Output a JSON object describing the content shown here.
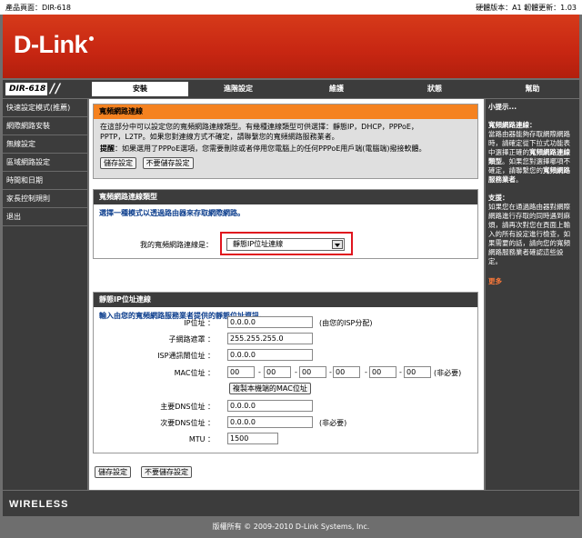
{
  "top": {
    "product": "產品頁面：DIR-618",
    "version": "硬體版本：A1   韌體更新：1.03"
  },
  "brand": {
    "logo": "D-Link",
    "wireless": "WIRELESS",
    "model": "DIR-618"
  },
  "tabs": [
    "安裝",
    "進階設定",
    "維護",
    "狀態",
    "幫助"
  ],
  "sidebar": [
    "快速設定模式(推薦)",
    "網際網路安裝",
    "無線設定",
    "區域網路設定",
    "時間和日期",
    "家長控制規則",
    "退出"
  ],
  "sec1": {
    "title": "寬頻網路連線",
    "line1": "在這部分中可以設定您的寬頻網路連線類型。有幾種連線類型可供選擇：靜態IP，DHCP，PPPoE，",
    "line2": "PPTP，L2TP。如果您對連線方式不確定，請聯繫您的寬頻網路服務業者。",
    "tip_label": "提醒",
    "tip": "：如果選用了PPPoE選項，您需要刪除或者停用您電腦上的任何PPPoE用戶端(電腦端)撥接軟體。",
    "save": "儲存設定",
    "nosave": "不要儲存設定"
  },
  "sec2": {
    "title": "寬頻網路連線類型",
    "prompt": "選擇一種模式以透過路由器來存取網際網路。",
    "label": "我的寬頻網路連線是：",
    "selected": "靜態IP位址連線"
  },
  "sec3": {
    "title": "靜態IP位址連線",
    "prompt": "輸入由您的寬頻網路服務業者提供的靜態位址資訊。",
    "ip_label": "IP位址 ：",
    "ip": "0.0.0.0",
    "ip_note": "(由您的ISP分配)",
    "mask_label": "子網路遮罩 ：",
    "mask": "255.255.255.0",
    "gw_label": "ISP通訊閘位址 ：",
    "gw": "0.0.0.0",
    "mac_label": "MAC位址 ：",
    "mac": [
      "00",
      "00",
      "00",
      "00",
      "00",
      "00"
    ],
    "mac_note": "(非必要)",
    "clone": "複製本機端的MAC位址",
    "dns1_label": "主要DNS位址 ：",
    "dns1": "0.0.0.0",
    "dns2_label": "次要DNS位址 ：",
    "dns2": "0.0.0.0",
    "dns2_note": "(非必要)",
    "mtu_label": "MTU ：",
    "mtu": "1500"
  },
  "bottom": {
    "save": "儲存設定",
    "nosave": "不要儲存設定"
  },
  "help": {
    "title": "小提示...",
    "p1_bold": "寬頻網路連線：",
    "p1": "當路由器能夠存取網際網路時，請確定從下拉式功能表中選擇正確的",
    "p1_bold2": "寬頻網路連線類型",
    "p1_end": "。如果您對選擇哪項不確定，請聯繫您的",
    "p1_bold3": "寬頻網路服務業者",
    "p2_bold": "支援：",
    "p2": "如果您在通過路由器對網際網路進行存取的同時遇到麻煩，請再次對您在頁面上輸入的所有設定進行檢查，如果需要的話，請向您的寬頻網路服務業者確認這些設定。",
    "more": "更多"
  },
  "footer": "版權所有 © 2009-2010 D-Link Systems, Inc."
}
